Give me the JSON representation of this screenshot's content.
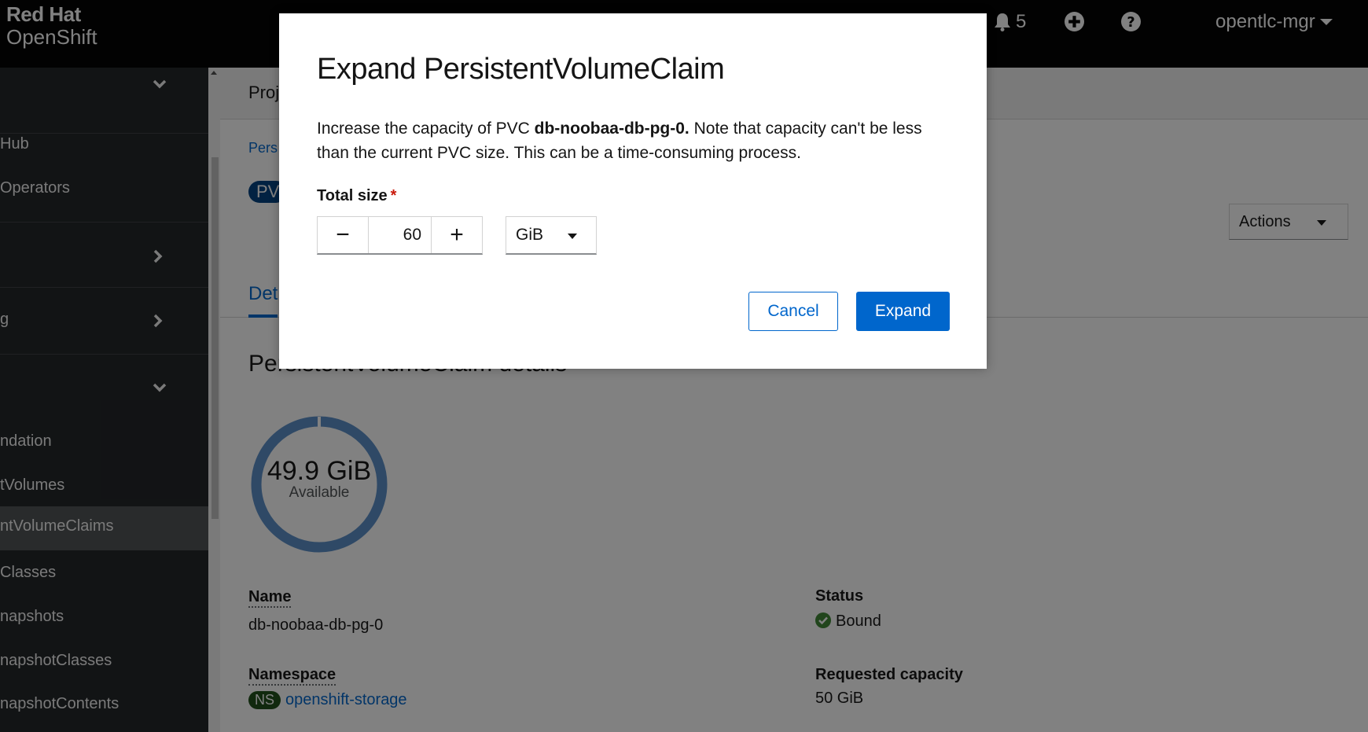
{
  "masthead": {
    "brand_line1": "Red Hat",
    "brand_line2": "OpenShift",
    "notifications_count": "5",
    "user_name": "opentlc-mgr"
  },
  "sidebar": {
    "items": [
      {
        "label": "Hub"
      },
      {
        "label": "Operators"
      },
      {
        "label": ""
      },
      {
        "label": "g"
      },
      {
        "label": "ndation"
      },
      {
        "label": "tVolumes"
      },
      {
        "label": "ntVolumeClaims"
      },
      {
        "label": "Classes"
      },
      {
        "label": "napshots"
      },
      {
        "label": "napshotClasses"
      },
      {
        "label": "napshotContents"
      }
    ]
  },
  "page": {
    "project_text": "Proj",
    "breadcrumb": "Pers",
    "resource_badge": "PV",
    "actions_label": "Actions",
    "active_tab": "Det",
    "details_title": "PersistentVolumeClaim details",
    "donut_value": "49.9 GiB",
    "donut_label": "Available",
    "donut_used_fraction": 0.002,
    "name_label": "Name",
    "name_value": "db-noobaa-db-pg-0",
    "namespace_label": "Namespace",
    "namespace_badge": "NS",
    "namespace_value": "openshift-storage",
    "status_label": "Status",
    "status_value": "Bound",
    "requested_capacity_label": "Requested capacity",
    "requested_capacity_value": "50 GiB"
  },
  "modal": {
    "title": "Expand PersistentVolumeClaim",
    "desc_prefix": "Increase the capacity of PVC ",
    "desc_pvc_name": "db-noobaa-db-pg-0.",
    "desc_suffix": " Note that capacity can't be less than the current PVC size. This can be a time-consuming process.",
    "field_label": "Total size",
    "required_mark": "*",
    "size_value": "60",
    "minus_symbol": "−",
    "plus_symbol": "+",
    "unit_value": "GiB",
    "cancel_label": "Cancel",
    "expand_label": "Expand"
  },
  "colors": {
    "primary": "#0066cc",
    "masthead_bg": "#000000",
    "sidebar_bg": "#212427",
    "donut": "#5b8fc8",
    "status_ok": "#3e8635"
  }
}
